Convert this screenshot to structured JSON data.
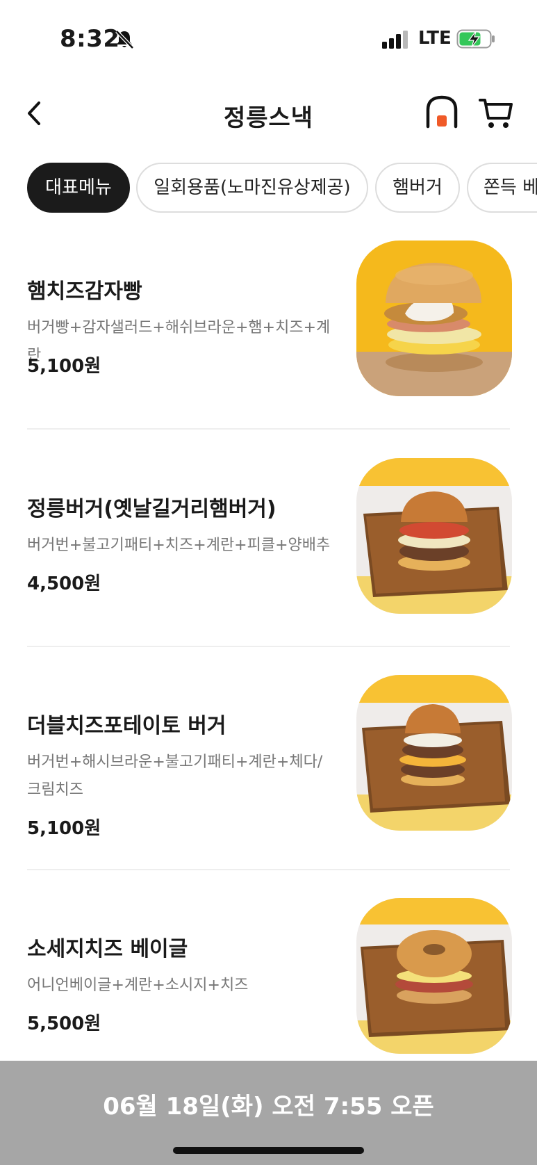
{
  "status_bar": {
    "time": "8:32",
    "network": "LTE"
  },
  "header": {
    "title": "정릉스낵"
  },
  "tabs": [
    {
      "label": "대표메뉴"
    },
    {
      "label": "일회용품(노마진유상제공)"
    },
    {
      "label": "햄버거"
    },
    {
      "label": "쫀득 베"
    }
  ],
  "menu": [
    {
      "name": "햄치즈감자빵",
      "desc": "버거빵+감자샐러드+해쉬브라운+햄+치즈+계란",
      "price": "5,100원"
    },
    {
      "name": "정릉버거(옛날길거리햄버거)",
      "desc": "버거번+불고기패티+치즈+계란+피클+양배추",
      "price": "4,500원"
    },
    {
      "name": "더블치즈포테이토 버거",
      "desc": "버거번+해시브라운+불고기패티+계란+체다/크림치즈",
      "price": "5,100원"
    },
    {
      "name": "소세지치즈 베이글",
      "desc": "어니언베이글+계란+소시지+치즈",
      "price": "5,500원"
    }
  ],
  "banner": {
    "text": "06월 18일(화) 오전 7:55 오픈"
  },
  "colors": {
    "accent": "#f05a28",
    "banner_bg": "#a6a6a6",
    "active_tab": "#1b1b1b"
  }
}
